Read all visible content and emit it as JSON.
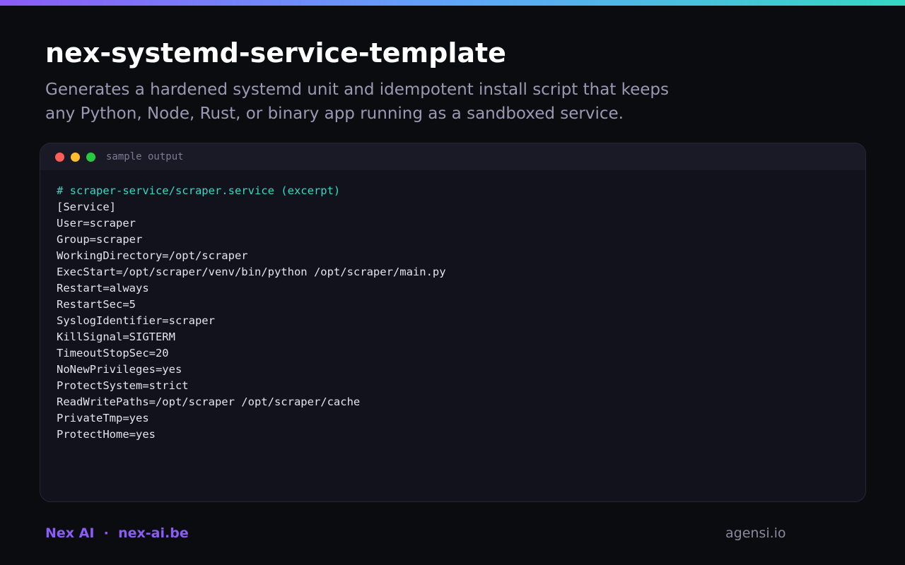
{
  "page": {
    "title": "nex-systemd-service-template",
    "subtitle": "Generates a hardened systemd unit and idempotent install script that keeps any Python, Node, Rust, or binary app running as a sandboxed service."
  },
  "terminal": {
    "title": "sample output",
    "lines": [
      "# scraper-service/scraper.service (excerpt)",
      "[Service]",
      "User=scraper",
      "Group=scraper",
      "WorkingDirectory=/opt/scraper",
      "ExecStart=/opt/scraper/venv/bin/python /opt/scraper/main.py",
      "Restart=always",
      "RestartSec=5",
      "SyslogIdentifier=scraper",
      "KillSignal=SIGTERM",
      "TimeoutStopSec=20",
      "NoNewPrivileges=yes",
      "ProtectSystem=strict",
      "ReadWritePaths=/opt/scraper /opt/scraper/cache",
      "PrivateTmp=yes",
      "ProtectHome=yes"
    ]
  },
  "footer": {
    "brand": "Nex AI",
    "separator": "·",
    "site": "nex-ai.be",
    "right": "agensi.io"
  },
  "colors": {
    "background": "#0b0c10",
    "accent": "#8b5cf6",
    "comment": "#34d9c3",
    "dot_red": "#ff5f57",
    "dot_yellow": "#febc2e",
    "dot_green": "#28c840"
  }
}
